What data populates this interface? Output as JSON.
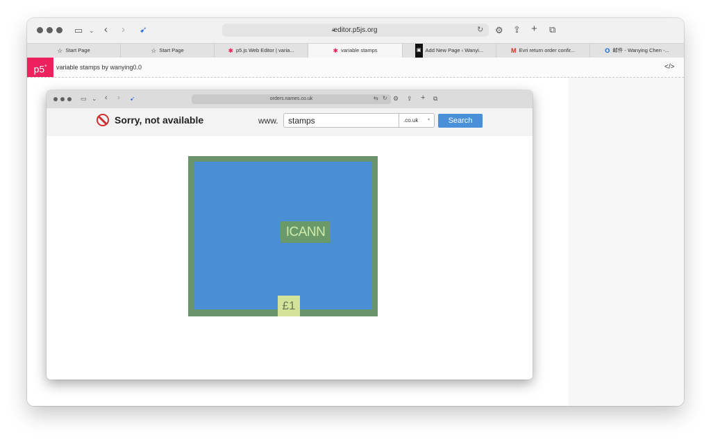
{
  "browser": {
    "url": "editor.p5js.org",
    "tabs": [
      {
        "label": "Start Page",
        "icon": "star-icon"
      },
      {
        "label": "Start Page",
        "icon": "star-icon"
      },
      {
        "label": "p5.js Web Editor | varia...",
        "icon": "p5-asterisk-icon"
      },
      {
        "label": "variable stamps",
        "icon": "p5-asterisk-icon"
      },
      {
        "label": "Add New Page ‹ Wanyi...",
        "icon": "wordpress-icon"
      },
      {
        "label": "Evri return order confir...",
        "icon": "gmail-icon"
      },
      {
        "label": "邮件 - Wanying Chen -...",
        "icon": "outlook-icon"
      }
    ]
  },
  "editor": {
    "logo": "p5",
    "logo_mark": "*",
    "sketch_title": "variable stamps by wanying0.0",
    "code_toggle": "</>"
  },
  "inner": {
    "url": "orders.names.co.uk",
    "sorry_text": "Sorry, not available",
    "www_label": "www.",
    "domain_value": "stamps",
    "tld": ".co.uk",
    "search_label": "Search"
  },
  "stamp": {
    "brand": "ICANN",
    "price": "£1"
  },
  "colors": {
    "stamp_border": "#6a956a",
    "stamp_face": "#4a8fd4",
    "price_tag": "#d4e39a",
    "search_button": "#4a90d9",
    "p5_brand": "#ed225d"
  }
}
